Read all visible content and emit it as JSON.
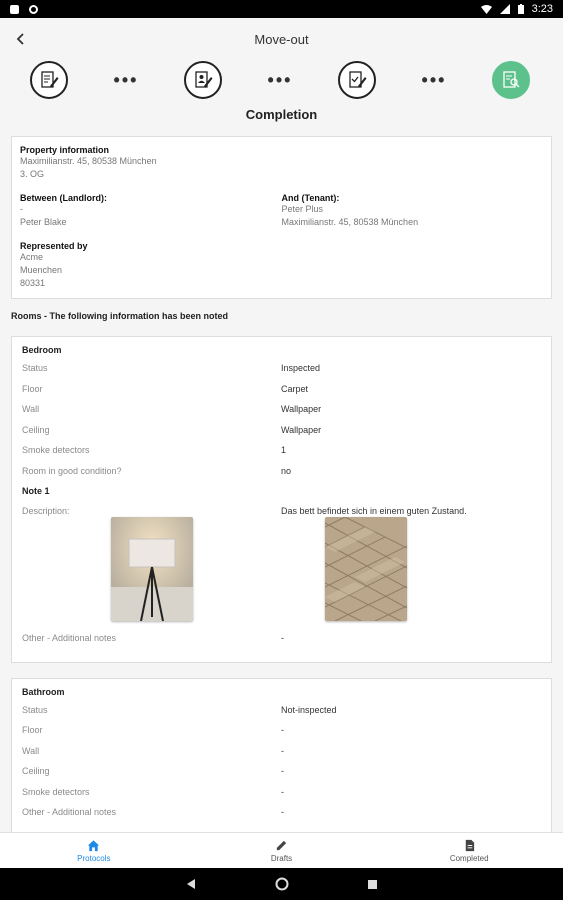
{
  "status_bar": {
    "time": "3:23"
  },
  "app_bar": {
    "title": "Move-out"
  },
  "page_title": "Completion",
  "property": {
    "heading": "Property information",
    "address": "Maximilianstr. 45, 80538 München",
    "floor": "3. OG",
    "landlord_heading": "Between (Landlord):",
    "landlord_line1": "-",
    "landlord_name": "Peter Blake",
    "tenant_heading": "And (Tenant):",
    "tenant_name": "Peter Plus",
    "tenant_address": "Maximilianstr. 45, 80538 München",
    "represented_heading": "Represented by",
    "rep_line1": "Acme",
    "rep_line2": "Muenchen",
    "rep_line3": "80331"
  },
  "rooms_heading": "Rooms - The following information has been noted",
  "bedroom": {
    "name": "Bedroom",
    "rows": [
      {
        "label": "Status",
        "value": "Inspected"
      },
      {
        "label": "Floor",
        "value": "Carpet"
      },
      {
        "label": "Wall",
        "value": "Wallpaper"
      },
      {
        "label": "Ceiling",
        "value": "Wallpaper"
      },
      {
        "label": "Smoke detectors",
        "value": "1"
      },
      {
        "label": "Room in good condition?",
        "value": "no"
      }
    ],
    "note_title": "Note 1",
    "description_label": "Description:",
    "description_value": "Das bett befindet sich in einem guten Zustand.",
    "other_label": "Other - Additional notes",
    "other_value": "-"
  },
  "bathroom": {
    "name": "Bathroom",
    "rows": [
      {
        "label": "Status",
        "value": "Not-inspected"
      },
      {
        "label": "Floor",
        "value": "-"
      },
      {
        "label": "Wall",
        "value": "-"
      },
      {
        "label": "Ceiling",
        "value": "-"
      },
      {
        "label": "Smoke detectors",
        "value": "-"
      },
      {
        "label": "Other - Additional notes",
        "value": "-"
      }
    ]
  },
  "bottom_nav": {
    "protocols": "Protocols",
    "drafts": "Drafts",
    "completed": "Completed"
  },
  "colors": {
    "accent": "#5cc18b",
    "nav_active": "#1e88e5"
  }
}
